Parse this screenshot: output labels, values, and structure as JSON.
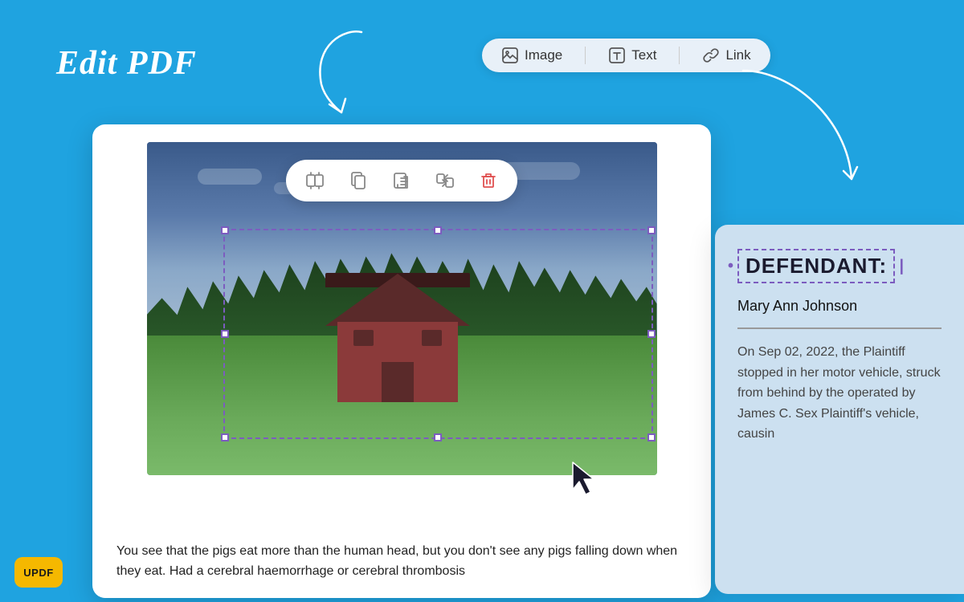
{
  "background_color": "#1fa3e0",
  "title": "Edit PDF",
  "toolbar": {
    "items": [
      {
        "id": "image",
        "label": "Image",
        "icon": "image-icon"
      },
      {
        "id": "text",
        "label": "Text",
        "icon": "text-icon"
      },
      {
        "id": "link",
        "label": "Link",
        "icon": "link-icon"
      }
    ]
  },
  "pdf_card": {
    "text_content": "You see that the pigs eat more than the human head, but you don't see any pigs falling down when they eat. Had a cerebral haemorrhage or cerebral thrombosis",
    "image_tools": [
      {
        "id": "replace",
        "icon": "replace-icon",
        "label": "Replace"
      },
      {
        "id": "crop",
        "icon": "crop-icon",
        "label": "Crop"
      },
      {
        "id": "extract",
        "icon": "extract-icon",
        "label": "Extract"
      },
      {
        "id": "convert",
        "icon": "convert-icon",
        "label": "Convert"
      },
      {
        "id": "delete",
        "icon": "delete-icon",
        "label": "Delete"
      }
    ]
  },
  "right_card": {
    "label": "DEFENDANT:",
    "name": "Mary Ann Johnson",
    "body_text": "On Sep 02, 2022, the Plaintiff stopped in her motor vehicle, struck from behind by the operated by James C. Sex Plaintiff's vehicle, causin"
  },
  "logo": {
    "text": "UPDF"
  }
}
